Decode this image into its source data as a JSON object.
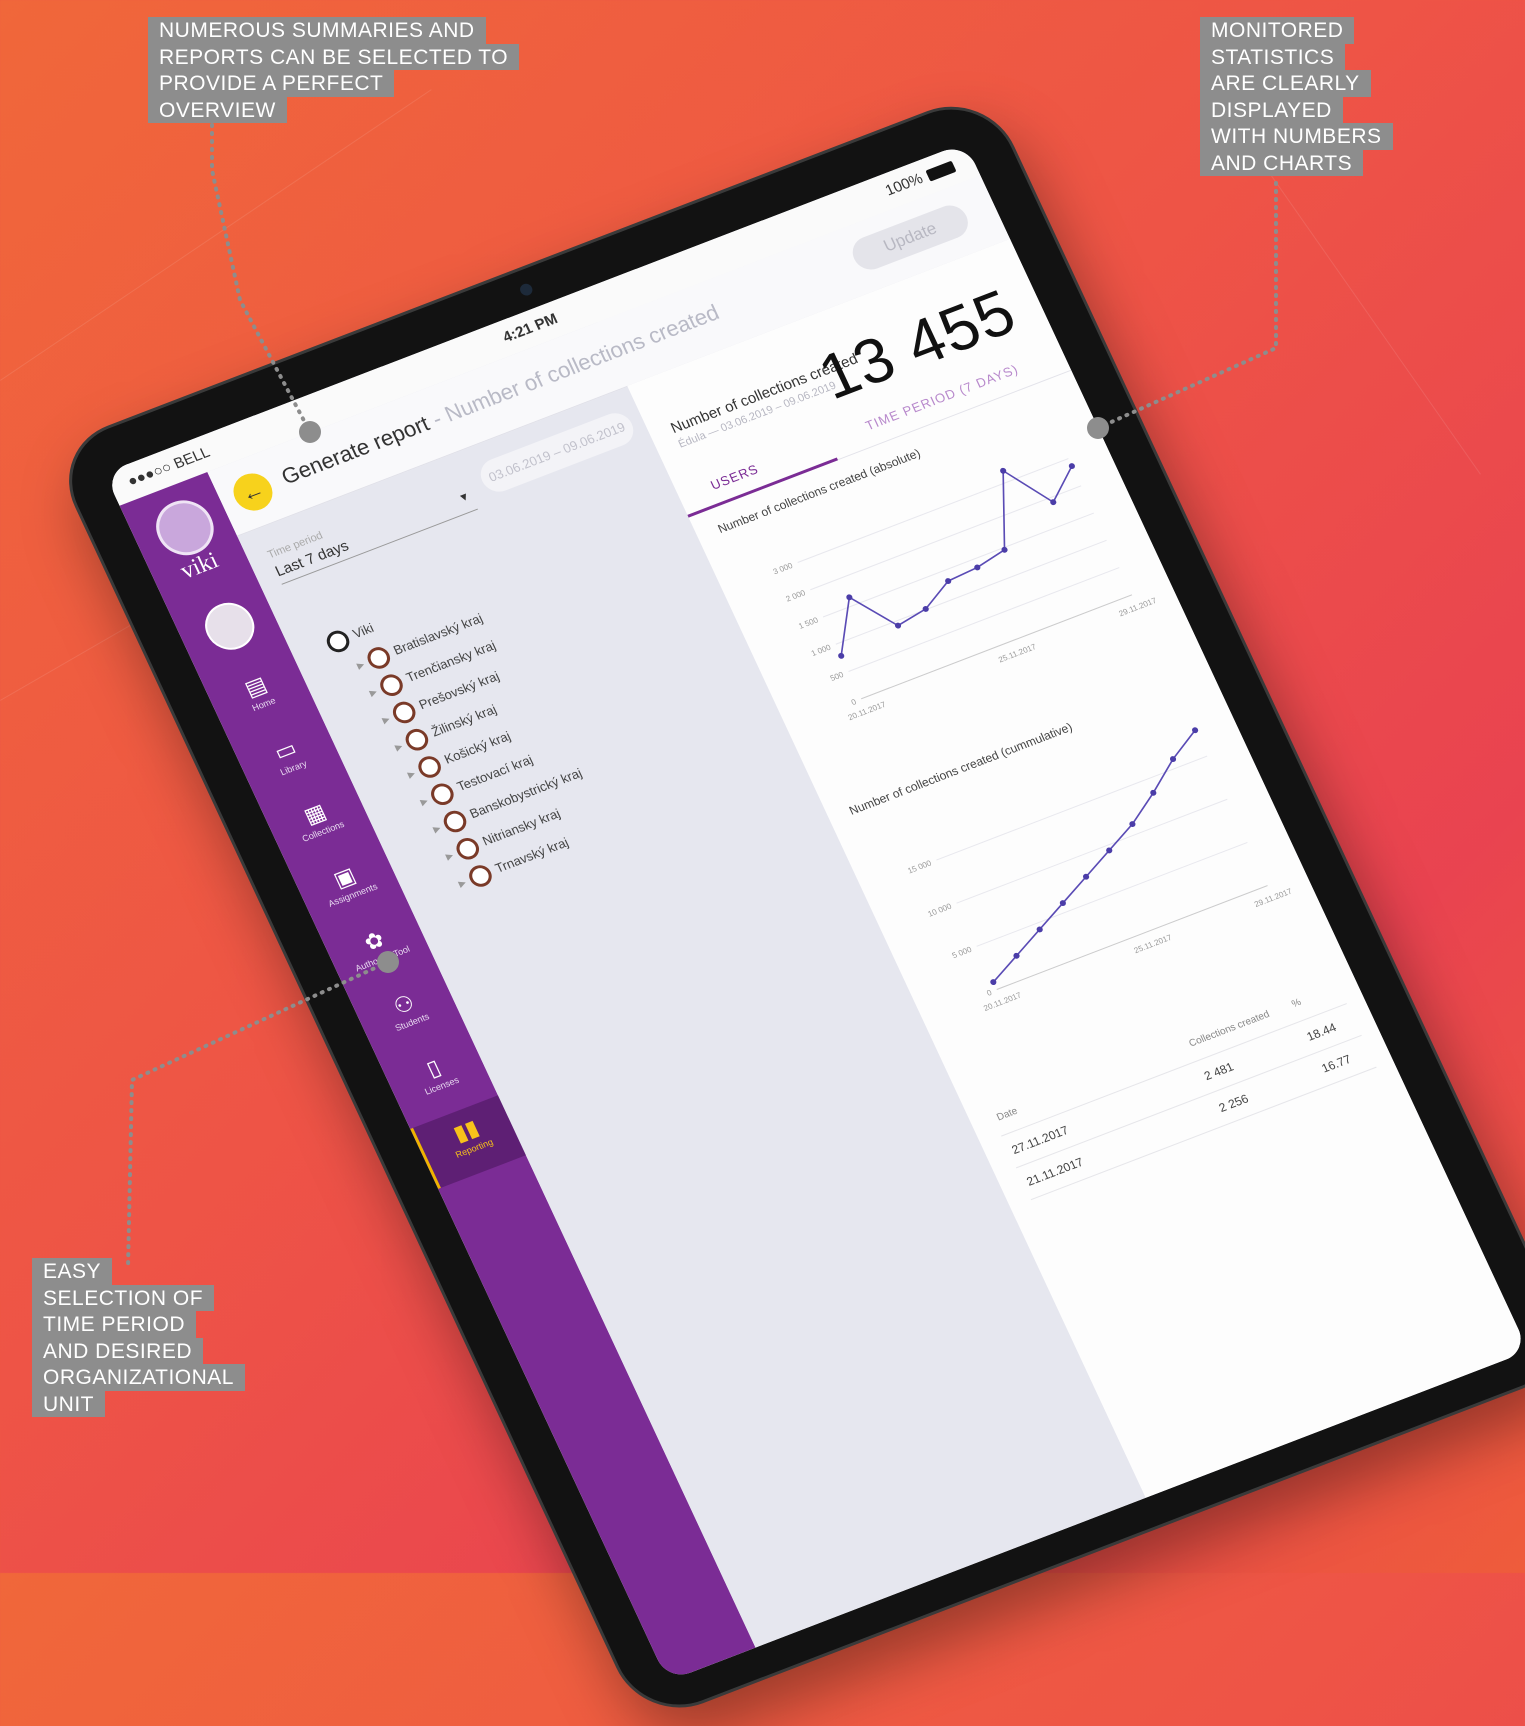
{
  "callouts": {
    "top_left": [
      "NUMEROUS SUMMARIES AND",
      "REPORTS CAN BE SELECTED TO",
      "PROVIDE A PERFECT",
      "OVERVIEW"
    ],
    "top_right": [
      "MONITORED",
      "STATISTICS",
      "ARE CLEARLY",
      "DISPLAYED",
      "WITH NUMBERS",
      "AND CHARTS"
    ],
    "bottom_left": [
      "EASY",
      "SELECTION OF",
      "TIME PERIOD",
      "AND DESIRED",
      "ORGANIZATIONAL",
      "UNIT"
    ]
  },
  "status": {
    "carrier": "●●●○○ BELL",
    "time": "4:21 PM",
    "battery": "100%"
  },
  "app": {
    "logo": "viki"
  },
  "sidebar": {
    "items": [
      {
        "icon": "home-icon",
        "glyph": "▤",
        "label": "Home"
      },
      {
        "icon": "library-icon",
        "glyph": "▭",
        "label": "Library"
      },
      {
        "icon": "collections-icon",
        "glyph": "▦",
        "label": "Collections"
      },
      {
        "icon": "assignments-icon",
        "glyph": "▣",
        "label": "Assignments"
      },
      {
        "icon": "authoring-tool-icon",
        "glyph": "✿",
        "label": "Authoring Tool"
      },
      {
        "icon": "students-icon",
        "glyph": "⚇",
        "label": "Students"
      },
      {
        "icon": "licenses-icon",
        "glyph": "▯",
        "label": "Licenses"
      },
      {
        "icon": "reporting-icon",
        "glyph": "▮▮",
        "label": "Reporting"
      }
    ]
  },
  "header": {
    "back_glyph": "←",
    "title": "Generate report",
    "subtitle": " - Number of collections created",
    "update_label": "Update"
  },
  "filters": {
    "period_caption": "Time period",
    "period_value": "Last 7 days",
    "date_range": "03.06.2019 – 09.06.2019"
  },
  "tree": [
    {
      "label": "Viki",
      "root": true
    },
    {
      "label": "Bratislavský kraj"
    },
    {
      "label": "Trenčiansky kraj"
    },
    {
      "label": "Prešovský kraj"
    },
    {
      "label": "Žilinský kraj"
    },
    {
      "label": "Košický kraj"
    },
    {
      "label": "Testovací kraj"
    },
    {
      "label": "Banskobystrický kraj"
    },
    {
      "label": "Nitriansky kraj"
    },
    {
      "label": "Trnavský kraj"
    }
  ],
  "report": {
    "metric_title": "Number of collections created",
    "metric_sub": "Édula — 03.06.2019 – 09.06.2019",
    "total": "13 455",
    "tab_users": "USERS",
    "tab_period": "TIME PERIOD (7 DAYS)"
  },
  "chart_data": [
    {
      "type": "line",
      "title": "Number of collections created (absolute)",
      "x": [
        "20.11.2017",
        "21.11.2017",
        "22.11.2017",
        "23.11.2017",
        "24.11.2017",
        "25.11.2017",
        "26.11.2017",
        "27.11.2017",
        "28.11.2017",
        "29.11.2017"
      ],
      "y": [
        2100,
        4400,
        2450,
        2700,
        3500,
        3600,
        3900,
        7200,
        5100,
        6300
      ],
      "yticks": [
        "0",
        "500",
        "1 000",
        "1 500",
        "2 000",
        "3 000"
      ],
      "xticks": [
        "20.11.2017",
        "25.11.2017",
        "29.11.2017"
      ],
      "ylim": [
        0,
        8000
      ]
    },
    {
      "type": "line",
      "title": "Number of collections created (cummulative)",
      "x": [
        "20.11.2017",
        "21.11.2017",
        "22.11.2017",
        "23.11.2017",
        "24.11.2017",
        "25.11.2017",
        "26.11.2017",
        "27.11.2017",
        "28.11.2017",
        "29.11.2017"
      ],
      "y": [
        3000,
        9000,
        15000,
        21000,
        27000,
        33000,
        39000,
        47000,
        56000,
        63000
      ],
      "yticks": [
        "0",
        "5 000",
        "10 000",
        "15 000"
      ],
      "xticks": [
        "20.11.2017",
        "25.11.2017",
        "29.11.2017"
      ],
      "ylim": [
        0,
        70000
      ]
    }
  ],
  "table": {
    "headers": [
      "Date",
      "Collections created",
      "%"
    ],
    "rows": [
      [
        "27.11.2017",
        "2 481",
        "18.44"
      ],
      [
        "21.11.2017",
        "2 256",
        "16.77"
      ]
    ]
  }
}
